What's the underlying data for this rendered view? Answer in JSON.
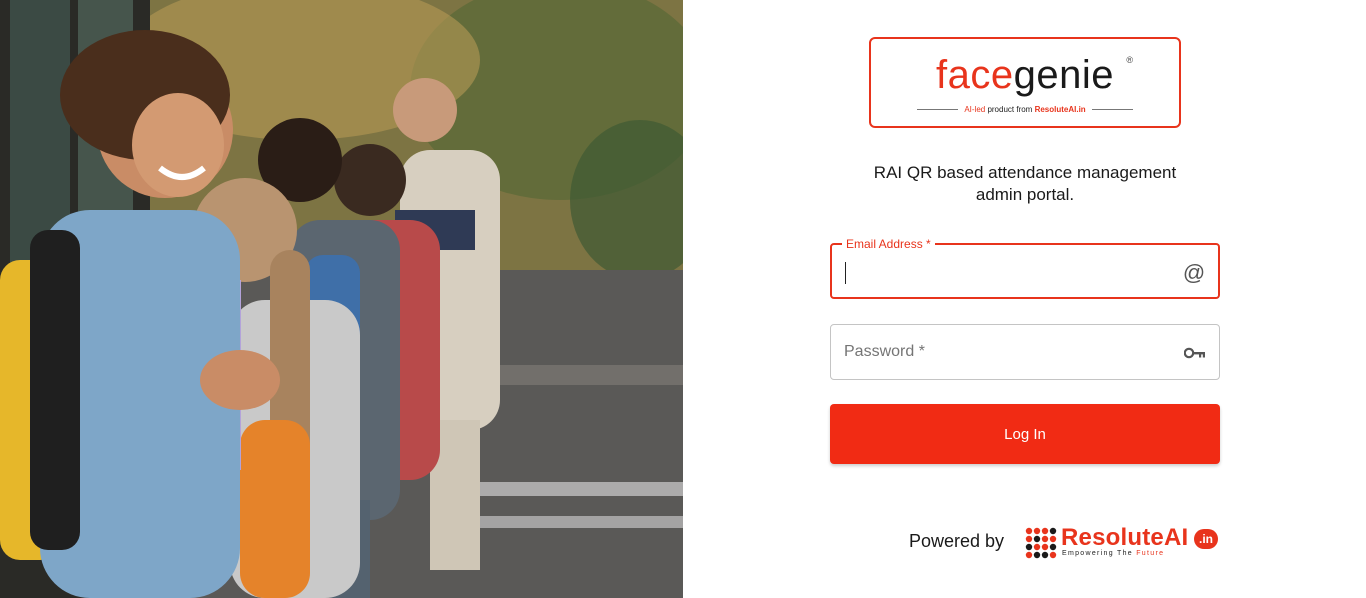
{
  "photo": {
    "alt": "Smiling schoolchildren with backpacks lined up beside a school bus"
  },
  "logo": {
    "face": "face",
    "genie": "genie",
    "registered": "®",
    "tagline_prefix": "AI-led",
    "tagline_middle": " product from ",
    "tagline_brand": "ResoluteAI.in"
  },
  "subtitle": {
    "line1": "RAI QR based attendance management",
    "line2": "admin portal."
  },
  "email": {
    "label": "Email Address *",
    "value": "",
    "icon": "at-icon"
  },
  "password": {
    "placeholder": "Password *",
    "icon": "key-icon"
  },
  "login_button": {
    "label": "Log In"
  },
  "footer": {
    "powered_by": "Powered by",
    "brand": "ResoluteAI",
    "brand_suffix": ".in",
    "tagline_main": "Empowering The ",
    "tagline_accent": "Future"
  },
  "colors": {
    "accent": "#e8341c",
    "button": "#f12b14"
  }
}
